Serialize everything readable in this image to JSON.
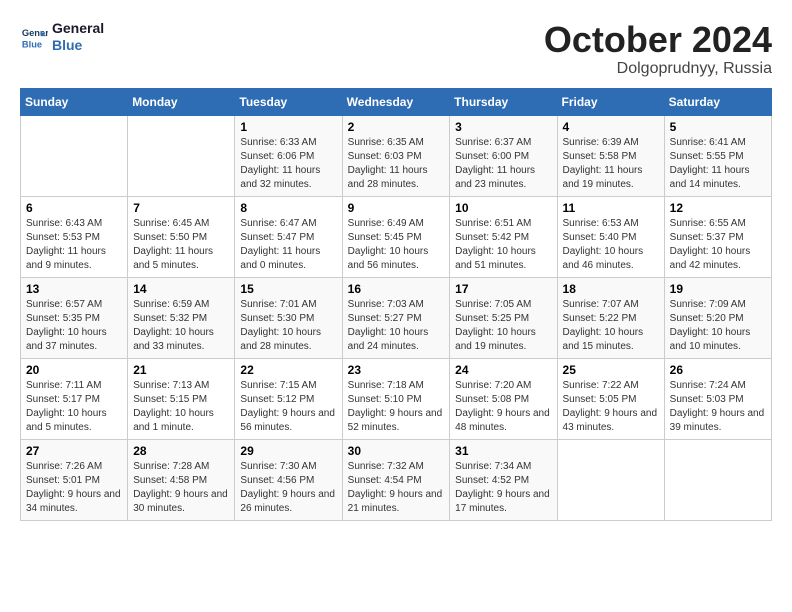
{
  "logo": {
    "line1": "General",
    "line2": "Blue"
  },
  "title": "October 2024",
  "location": "Dolgoprudnyy, Russia",
  "days_header": [
    "Sunday",
    "Monday",
    "Tuesday",
    "Wednesday",
    "Thursday",
    "Friday",
    "Saturday"
  ],
  "weeks": [
    [
      {
        "day": "",
        "info": ""
      },
      {
        "day": "",
        "info": ""
      },
      {
        "day": "1",
        "info": "Sunrise: 6:33 AM\nSunset: 6:06 PM\nDaylight: 11 hours and 32 minutes."
      },
      {
        "day": "2",
        "info": "Sunrise: 6:35 AM\nSunset: 6:03 PM\nDaylight: 11 hours and 28 minutes."
      },
      {
        "day": "3",
        "info": "Sunrise: 6:37 AM\nSunset: 6:00 PM\nDaylight: 11 hours and 23 minutes."
      },
      {
        "day": "4",
        "info": "Sunrise: 6:39 AM\nSunset: 5:58 PM\nDaylight: 11 hours and 19 minutes."
      },
      {
        "day": "5",
        "info": "Sunrise: 6:41 AM\nSunset: 5:55 PM\nDaylight: 11 hours and 14 minutes."
      }
    ],
    [
      {
        "day": "6",
        "info": "Sunrise: 6:43 AM\nSunset: 5:53 PM\nDaylight: 11 hours and 9 minutes."
      },
      {
        "day": "7",
        "info": "Sunrise: 6:45 AM\nSunset: 5:50 PM\nDaylight: 11 hours and 5 minutes."
      },
      {
        "day": "8",
        "info": "Sunrise: 6:47 AM\nSunset: 5:47 PM\nDaylight: 11 hours and 0 minutes."
      },
      {
        "day": "9",
        "info": "Sunrise: 6:49 AM\nSunset: 5:45 PM\nDaylight: 10 hours and 56 minutes."
      },
      {
        "day": "10",
        "info": "Sunrise: 6:51 AM\nSunset: 5:42 PM\nDaylight: 10 hours and 51 minutes."
      },
      {
        "day": "11",
        "info": "Sunrise: 6:53 AM\nSunset: 5:40 PM\nDaylight: 10 hours and 46 minutes."
      },
      {
        "day": "12",
        "info": "Sunrise: 6:55 AM\nSunset: 5:37 PM\nDaylight: 10 hours and 42 minutes."
      }
    ],
    [
      {
        "day": "13",
        "info": "Sunrise: 6:57 AM\nSunset: 5:35 PM\nDaylight: 10 hours and 37 minutes."
      },
      {
        "day": "14",
        "info": "Sunrise: 6:59 AM\nSunset: 5:32 PM\nDaylight: 10 hours and 33 minutes."
      },
      {
        "day": "15",
        "info": "Sunrise: 7:01 AM\nSunset: 5:30 PM\nDaylight: 10 hours and 28 minutes."
      },
      {
        "day": "16",
        "info": "Sunrise: 7:03 AM\nSunset: 5:27 PM\nDaylight: 10 hours and 24 minutes."
      },
      {
        "day": "17",
        "info": "Sunrise: 7:05 AM\nSunset: 5:25 PM\nDaylight: 10 hours and 19 minutes."
      },
      {
        "day": "18",
        "info": "Sunrise: 7:07 AM\nSunset: 5:22 PM\nDaylight: 10 hours and 15 minutes."
      },
      {
        "day": "19",
        "info": "Sunrise: 7:09 AM\nSunset: 5:20 PM\nDaylight: 10 hours and 10 minutes."
      }
    ],
    [
      {
        "day": "20",
        "info": "Sunrise: 7:11 AM\nSunset: 5:17 PM\nDaylight: 10 hours and 5 minutes."
      },
      {
        "day": "21",
        "info": "Sunrise: 7:13 AM\nSunset: 5:15 PM\nDaylight: 10 hours and 1 minute."
      },
      {
        "day": "22",
        "info": "Sunrise: 7:15 AM\nSunset: 5:12 PM\nDaylight: 9 hours and 56 minutes."
      },
      {
        "day": "23",
        "info": "Sunrise: 7:18 AM\nSunset: 5:10 PM\nDaylight: 9 hours and 52 minutes."
      },
      {
        "day": "24",
        "info": "Sunrise: 7:20 AM\nSunset: 5:08 PM\nDaylight: 9 hours and 48 minutes."
      },
      {
        "day": "25",
        "info": "Sunrise: 7:22 AM\nSunset: 5:05 PM\nDaylight: 9 hours and 43 minutes."
      },
      {
        "day": "26",
        "info": "Sunrise: 7:24 AM\nSunset: 5:03 PM\nDaylight: 9 hours and 39 minutes."
      }
    ],
    [
      {
        "day": "27",
        "info": "Sunrise: 7:26 AM\nSunset: 5:01 PM\nDaylight: 9 hours and 34 minutes."
      },
      {
        "day": "28",
        "info": "Sunrise: 7:28 AM\nSunset: 4:58 PM\nDaylight: 9 hours and 30 minutes."
      },
      {
        "day": "29",
        "info": "Sunrise: 7:30 AM\nSunset: 4:56 PM\nDaylight: 9 hours and 26 minutes."
      },
      {
        "day": "30",
        "info": "Sunrise: 7:32 AM\nSunset: 4:54 PM\nDaylight: 9 hours and 21 minutes."
      },
      {
        "day": "31",
        "info": "Sunrise: 7:34 AM\nSunset: 4:52 PM\nDaylight: 9 hours and 17 minutes."
      },
      {
        "day": "",
        "info": ""
      },
      {
        "day": "",
        "info": ""
      }
    ]
  ]
}
